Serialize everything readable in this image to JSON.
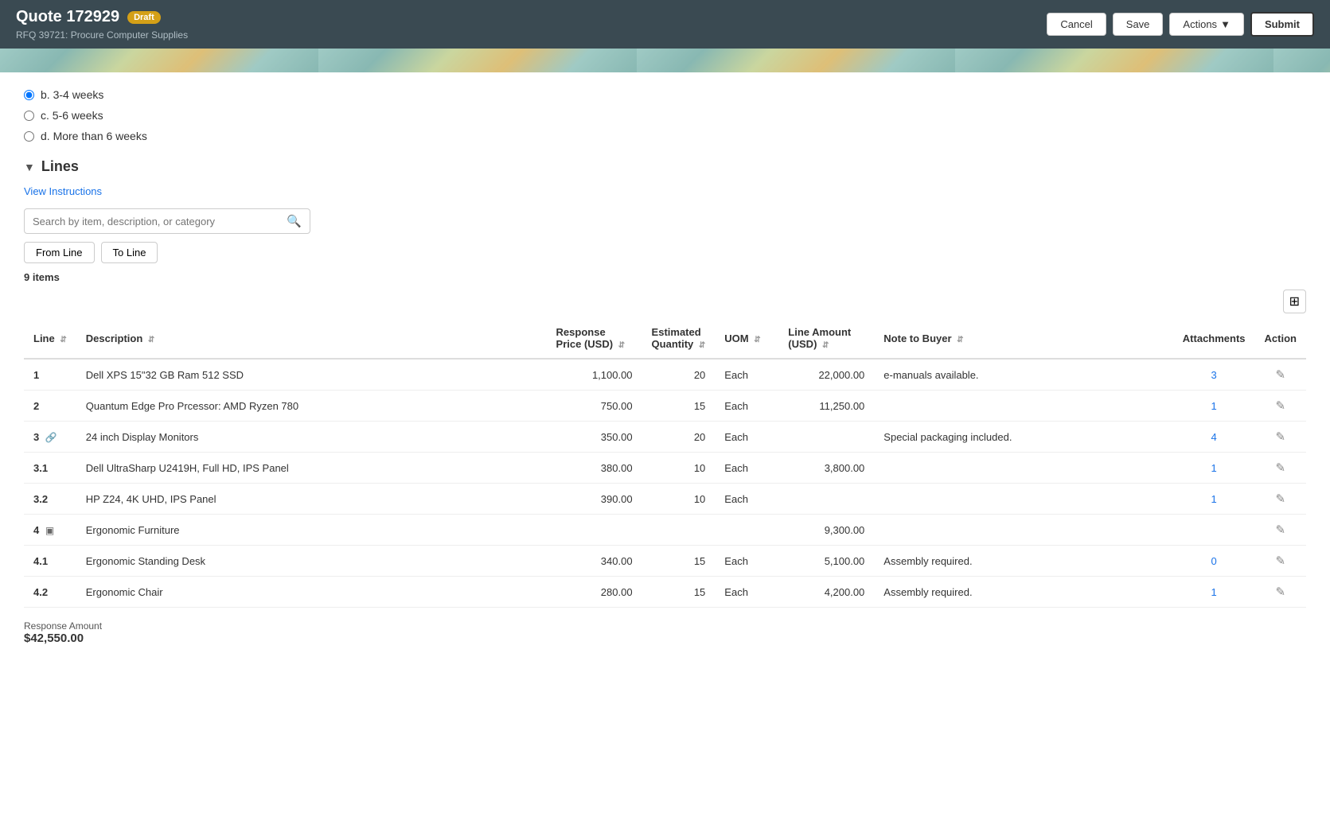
{
  "header": {
    "title": "Quote 172929",
    "badge": "Draft",
    "subtitle": "RFQ 39721: Procure Computer Supplies",
    "actions": {
      "cancel": "Cancel",
      "save": "Save",
      "actions": "Actions",
      "submit": "Submit"
    }
  },
  "radio_options": [
    {
      "id": "b",
      "label": "b. 3-4 weeks",
      "checked": true
    },
    {
      "id": "c",
      "label": "c. 5-6 weeks",
      "checked": false
    },
    {
      "id": "d",
      "label": "d. More than 6 weeks",
      "checked": false
    }
  ],
  "lines_section": {
    "title": "Lines",
    "view_instructions": "View Instructions",
    "search_placeholder": "Search by item, description, or category",
    "filter_from": "From Line",
    "filter_to": "To Line",
    "items_count": "9 items"
  },
  "table": {
    "columns": [
      {
        "id": "line",
        "label": "Line",
        "sortable": true
      },
      {
        "id": "description",
        "label": "Description",
        "sortable": true
      },
      {
        "id": "response_price",
        "label": "Response Price (USD)",
        "sortable": true
      },
      {
        "id": "est_quantity",
        "label": "Estimated Quantity",
        "sortable": true
      },
      {
        "id": "uom",
        "label": "UOM",
        "sortable": true
      },
      {
        "id": "line_amount",
        "label": "Line Amount (USD)",
        "sortable": true
      },
      {
        "id": "note_to_buyer",
        "label": "Note to Buyer",
        "sortable": true
      },
      {
        "id": "attachments",
        "label": "Attachments",
        "sortable": false
      },
      {
        "id": "action",
        "label": "Action",
        "sortable": false
      }
    ],
    "rows": [
      {
        "line": "1",
        "line_icon": null,
        "description": "Dell XPS 15\"32 GB Ram 512 SSD",
        "response_price": "1,100.00",
        "est_quantity": "20",
        "uom": "Each",
        "line_amount": "22,000.00",
        "note": "e-manuals available.",
        "attachments": "3",
        "editable": true
      },
      {
        "line": "2",
        "line_icon": null,
        "description": "Quantum Edge Pro Prcessor: AMD Ryzen 780",
        "response_price": "750.00",
        "est_quantity": "15",
        "uom": "Each",
        "line_amount": "11,250.00",
        "note": "",
        "attachments": "1",
        "editable": true
      },
      {
        "line": "3",
        "line_icon": "link",
        "description": "24 inch Display Monitors",
        "response_price": "350.00",
        "est_quantity": "20",
        "uom": "Each",
        "line_amount": "",
        "note": "Special packaging included.",
        "attachments": "4",
        "editable": true
      },
      {
        "line": "3.1",
        "line_icon": null,
        "description": "Dell UltraSharp U2419H, Full HD, IPS Panel",
        "response_price": "380.00",
        "est_quantity": "10",
        "uom": "Each",
        "line_amount": "3,800.00",
        "note": "",
        "attachments": "1",
        "editable": true
      },
      {
        "line": "3.2",
        "line_icon": null,
        "description": "HP Z24, 4K UHD, IPS Panel",
        "response_price": "390.00",
        "est_quantity": "10",
        "uom": "Each",
        "line_amount": "",
        "note": "",
        "attachments": "1",
        "editable": true
      },
      {
        "line": "4",
        "line_icon": "grid",
        "description": "Ergonomic Furniture",
        "response_price": "",
        "est_quantity": "",
        "uom": "",
        "line_amount": "9,300.00",
        "note": "",
        "attachments": "",
        "editable": true
      },
      {
        "line": "4.1",
        "line_icon": null,
        "description": "Ergonomic Standing Desk",
        "response_price": "340.00",
        "est_quantity": "15",
        "uom": "Each",
        "line_amount": "5,100.00",
        "note": "Assembly required.",
        "attachments": "0",
        "editable": true
      },
      {
        "line": "4.2",
        "line_icon": null,
        "description": "Ergonomic Chair",
        "response_price": "280.00",
        "est_quantity": "15",
        "uom": "Each",
        "line_amount": "4,200.00",
        "note": "Assembly required.",
        "attachments": "1",
        "editable": true
      }
    ]
  },
  "footer": {
    "response_amount_label": "Response Amount",
    "response_amount_value": "$42,550.00"
  }
}
